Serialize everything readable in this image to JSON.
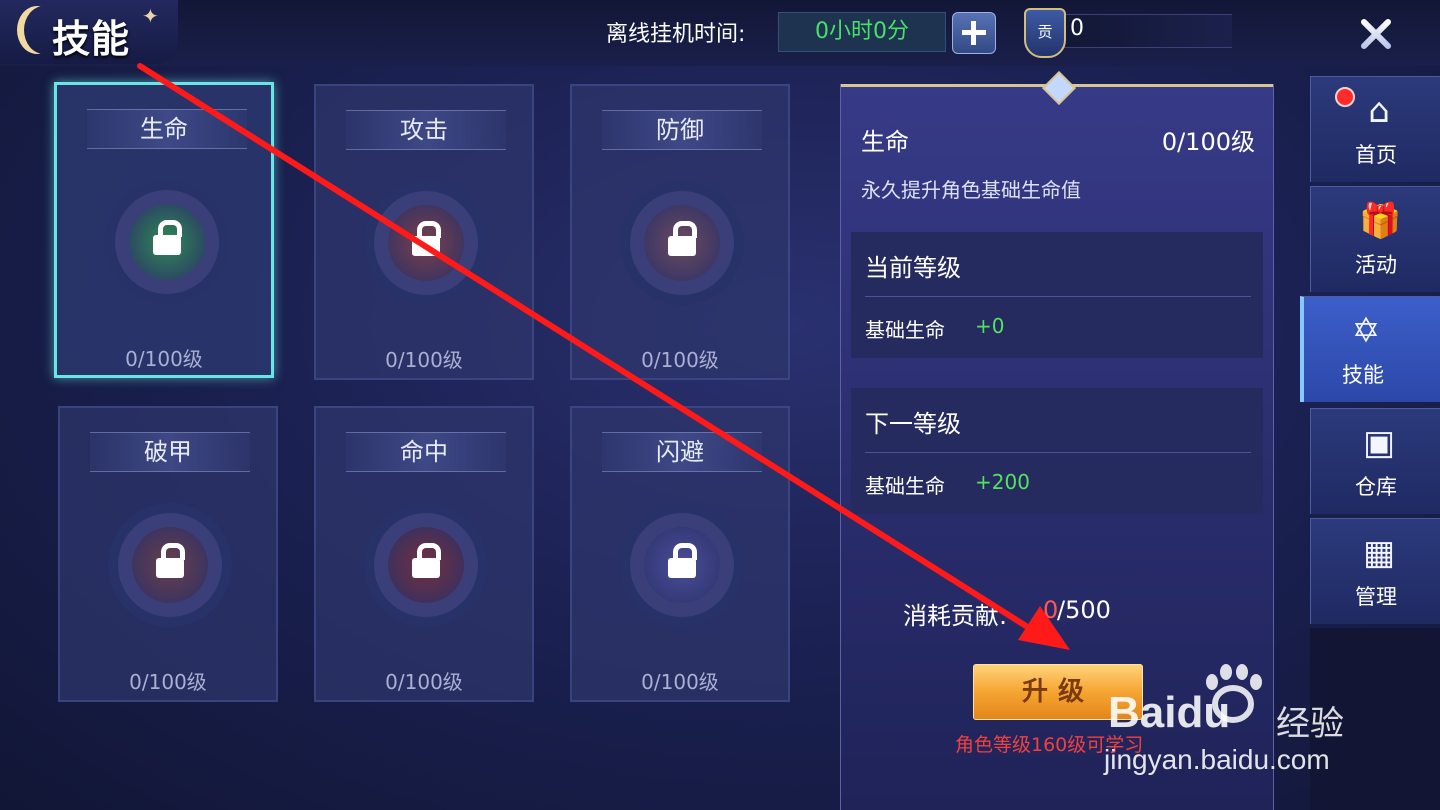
{
  "header": {
    "title": "技能",
    "offline_label": "离线挂机时间:",
    "offline_value": "0小时0分",
    "badge_label": "贡",
    "badge_value": "0"
  },
  "skills": [
    {
      "name": "生命",
      "level": "0/100级",
      "color": "#2f8a55",
      "selected": true
    },
    {
      "name": "攻击",
      "level": "0/100级",
      "color": "#7a3f4a",
      "selected": false
    },
    {
      "name": "防御",
      "level": "0/100级",
      "color": "#6b4a5e",
      "selected": false
    },
    {
      "name": "破甲",
      "level": "0/100级",
      "color": "#6a3e4c",
      "selected": false
    },
    {
      "name": "命中",
      "level": "0/100级",
      "color": "#73303f",
      "selected": false
    },
    {
      "name": "闪避",
      "level": "0/100级",
      "color": "#4a4f9a",
      "selected": false
    }
  ],
  "detail": {
    "name": "生命",
    "level": "0/100级",
    "description": "永久提升角色基础生命值",
    "current": {
      "title": "当前等级",
      "stat": "基础生命",
      "value": "+0"
    },
    "next": {
      "title": "下一等级",
      "stat": "基础生命",
      "value": "+200"
    },
    "cost_label": "消耗贡献:",
    "cost_current": "0",
    "cost_max": "/500",
    "upgrade_label": "升级",
    "requirement": "角色等级160级可学习"
  },
  "nav": [
    {
      "label": "首页",
      "icon": "home-icon",
      "active": false,
      "dot": true
    },
    {
      "label": "活动",
      "icon": "gift-icon",
      "active": false,
      "dot": false
    },
    {
      "label": "技能",
      "icon": "hexagram-icon",
      "active": true,
      "dot": false
    },
    {
      "label": "仓库",
      "icon": "box-icon",
      "active": false,
      "dot": false
    },
    {
      "label": "管理",
      "icon": "grid-icon",
      "active": false,
      "dot": false
    }
  ],
  "watermark": {
    "brand": "Baidu",
    "cn": "经验",
    "url": "jingyan.baidu.com"
  },
  "annotation": {
    "arrow_color": "#ff1a1a"
  }
}
